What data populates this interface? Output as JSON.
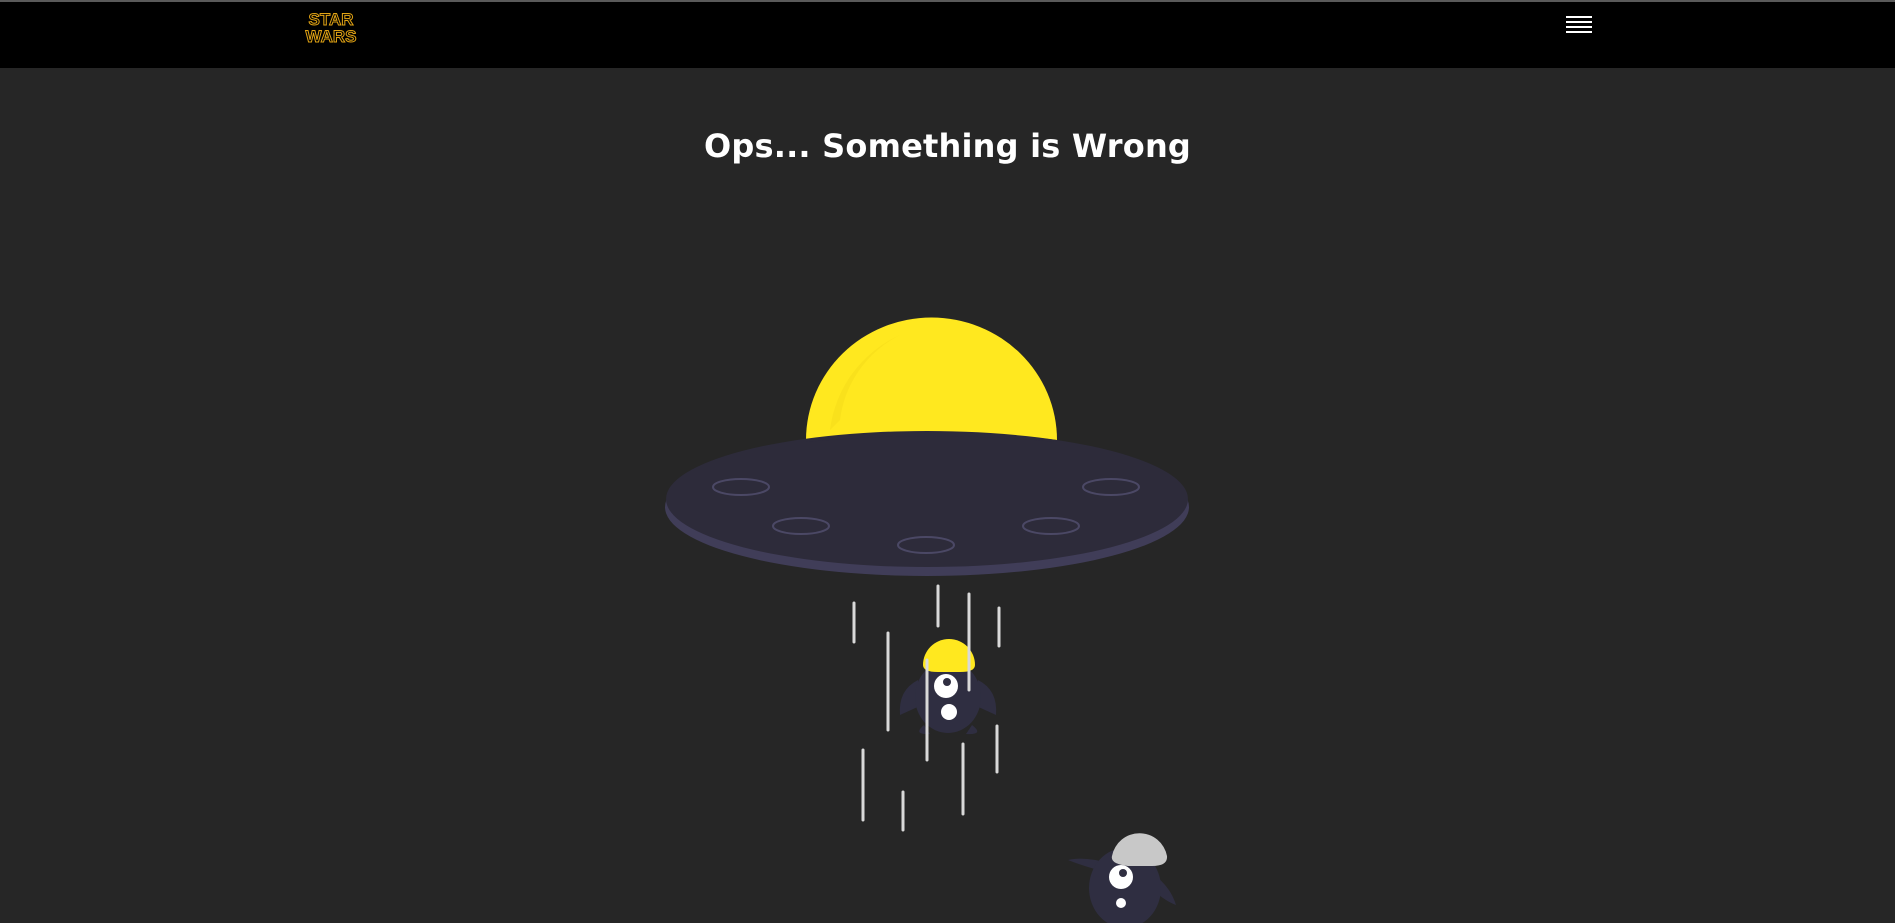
{
  "header": {
    "logo_text_line1": "STAR",
    "logo_text_line2": "WARS",
    "logo_color": "#e1a314",
    "menu_icon": "hamburger-menu-icon"
  },
  "main": {
    "title": "Ops... Something is Wrong"
  },
  "illustration": {
    "ufo_dome_color": "#ffe81f",
    "ufo_saucer_color": "#2d2b3a",
    "ufo_rim_color": "#403d58",
    "beam_color": "#d9d9d9",
    "alien_body_color": "#2f2e41",
    "alien_helmet_primary": "#ffe81f",
    "alien_helmet_secondary": "#c8c8c8"
  }
}
